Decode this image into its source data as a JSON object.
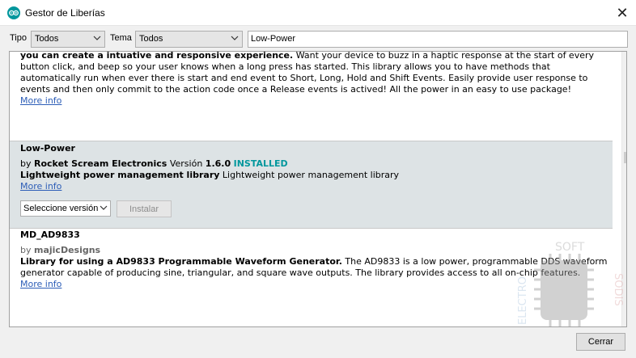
{
  "window": {
    "title": "Gestor de Liberías",
    "close_glyph": "✕",
    "app_icon": "arduino-logo-icon"
  },
  "filters": {
    "tipo_label": "Tipo",
    "tipo_value": "Todos",
    "tema_label": "Tema",
    "tema_value": "Todos",
    "search_value": "Low-Power"
  },
  "entries": {
    "previous": {
      "line1_bold": "you can create a intuative and responsive experience.",
      "line1_rest": " Want your device to buzz in a haptic response at the start of every",
      "line2": "button click, and beep so your user knows when a long press has started. This library allows you to have methods that",
      "line3": "automatically run when ever there is start and end event to Short, Long, Hold and Shift Events. Easily provide user response to",
      "line4": "events and then only commit to the action code once a Release events is actived! All the power in an easy to use package!",
      "more_info": "More info"
    },
    "low_power": {
      "name": "Low-Power",
      "by": "by",
      "author": "Rocket Scream Electronics",
      "version_label": "Versión",
      "version": "1.6.0",
      "status": "INSTALLED",
      "summary_bold": "Lightweight power management library",
      "summary_rest": " Lightweight power management library",
      "more_info": "More info",
      "version_select": "Seleccione versión",
      "install_button": "Instalar"
    },
    "md_ad9833": {
      "name": "MD_AD9833",
      "by": "by",
      "author": "majicDesigns",
      "summary_bold": "Library for using a AD9833 Programmable Waveform Generator.",
      "summary_rest": " The AD9833 is a low power, programmable DDS waveform",
      "line2": "generator capable of producing sine, triangular, and square wave outputs. The library provides access to all on-chip features.",
      "more_info": "More info"
    }
  },
  "watermark": {
    "top_text": "SOFT",
    "left_text": "ELECTRO",
    "right_text": "SODIS"
  },
  "footer": {
    "close_button": "Cerrar"
  },
  "colors": {
    "accent": "#00979d",
    "link": "#2c5db7",
    "selected_bg": "#dde3e5"
  }
}
